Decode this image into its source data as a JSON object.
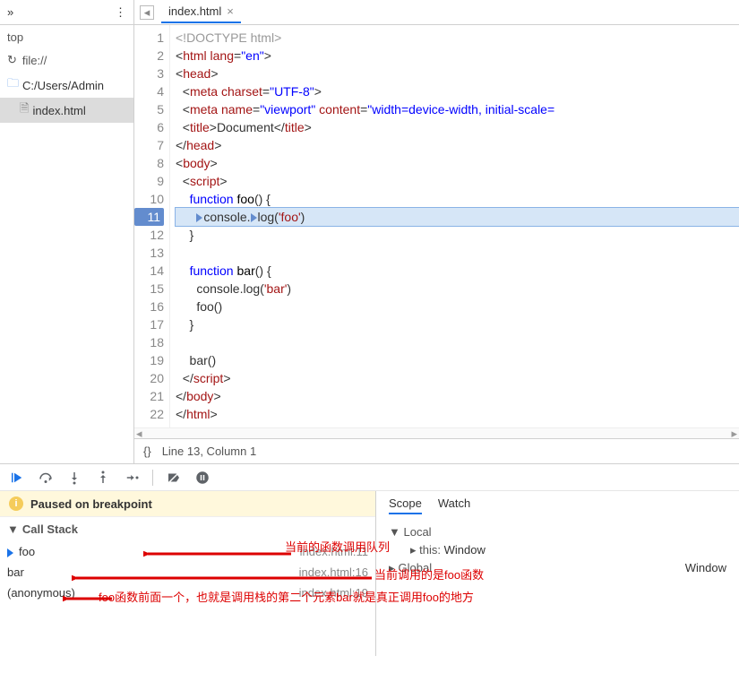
{
  "toolbar": {
    "collapse_label": "»",
    "more_label": "⋮"
  },
  "tab": {
    "icon": "document-icon",
    "filename": "index.html",
    "close": "×"
  },
  "sidebar": {
    "context": "top",
    "refresh_label": "file://",
    "folder": "C:/Users/Admin",
    "file": "index.html"
  },
  "code": {
    "lines": [
      {
        "n": 1,
        "html": "<span class='tok-doctype'>&lt;!DOCTYPE html&gt;</span>"
      },
      {
        "n": 2,
        "html": "&lt;<span class='tok-tag'>html</span> <span class='tok-attr'>lang</span>=<span class='tok-str'>\"en\"</span>&gt;"
      },
      {
        "n": 3,
        "html": "&lt;<span class='tok-tag'>head</span>&gt;"
      },
      {
        "n": 4,
        "html": "  &lt;<span class='tok-tag'>meta</span> <span class='tok-attr'>charset</span>=<span class='tok-str'>\"UTF-8\"</span>&gt;"
      },
      {
        "n": 5,
        "html": "  &lt;<span class='tok-tag'>meta</span> <span class='tok-attr'>name</span>=<span class='tok-str'>\"viewport\"</span> <span class='tok-attr'>content</span>=<span class='tok-str'>\"width=device-width, initial-scale=</span>"
      },
      {
        "n": 6,
        "html": "  &lt;<span class='tok-tag'>title</span>&gt;Document&lt;/<span class='tok-tag'>title</span>&gt;"
      },
      {
        "n": 7,
        "html": "&lt;/<span class='tok-tag'>head</span>&gt;"
      },
      {
        "n": 8,
        "html": "&lt;<span class='tok-tag'>body</span>&gt;"
      },
      {
        "n": 9,
        "html": "  &lt;<span class='tok-tag'>script</span>&gt;"
      },
      {
        "n": 10,
        "html": "    <span class='tok-kw'>function</span> <span class='tok-fn'>foo</span>() {"
      },
      {
        "n": 11,
        "html": "      <span class='marker'></span>console.<span class='marker'></span>log(<span class='tok-lit'>'foo'</span>)",
        "bp": true,
        "hl": true
      },
      {
        "n": 12,
        "html": "    }"
      },
      {
        "n": 13,
        "html": ""
      },
      {
        "n": 14,
        "html": "    <span class='tok-kw'>function</span> <span class='tok-fn'>bar</span>() {"
      },
      {
        "n": 15,
        "html": "      console.log(<span class='tok-lit'>'bar'</span>)"
      },
      {
        "n": 16,
        "html": "      foo()"
      },
      {
        "n": 17,
        "html": "    }"
      },
      {
        "n": 18,
        "html": ""
      },
      {
        "n": 19,
        "html": "    bar()"
      },
      {
        "n": 20,
        "html": "  &lt;/<span class='tok-tag'>script</span>&gt;"
      },
      {
        "n": 21,
        "html": "&lt;/<span class='tok-tag'>body</span>&gt;"
      },
      {
        "n": 22,
        "html": "&lt;/<span class='tok-tag'>html</span>&gt;"
      }
    ]
  },
  "status": {
    "braces": "{}",
    "cursor": "Line 13, Column 1"
  },
  "debugger": {
    "paused_text": "Paused on breakpoint",
    "callstack_label": "Call Stack",
    "frames": [
      {
        "fn": "foo",
        "loc": "index.html:11",
        "active": true
      },
      {
        "fn": "bar",
        "loc": "index.html:16"
      },
      {
        "fn": "(anonymous)",
        "loc": "index.html:19"
      }
    ],
    "scope": {
      "tab_scope": "Scope",
      "tab_watch": "Watch",
      "local_label": "Local",
      "this_label": "this:",
      "this_value": "Window",
      "global_label": "Global",
      "global_value": "Window"
    }
  },
  "annotations": {
    "a1": "当前的函数调用队列",
    "a2": "当前调用的是foo函数",
    "a3": "foo函数前面一个，也就是调用栈的第二个元素bar就是真正调用foo的地方"
  }
}
